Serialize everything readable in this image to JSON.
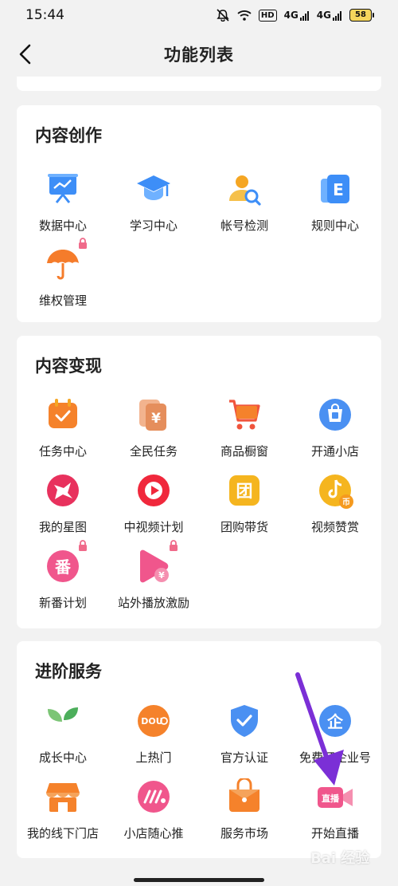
{
  "status_bar": {
    "time": "15:44",
    "hd": "HD",
    "signal1": "4G",
    "signal2": "4G",
    "battery": "58"
  },
  "nav": {
    "title": "功能列表"
  },
  "sections": [
    {
      "title": "内容创作",
      "items": [
        {
          "label": "数据中心",
          "icon": "presentation-chart-icon",
          "locked": false
        },
        {
          "label": "学习中心",
          "icon": "graduation-cap-icon",
          "locked": false
        },
        {
          "label": "帐号检测",
          "icon": "user-search-icon",
          "locked": false
        },
        {
          "label": "规则中心",
          "icon": "rulebook-icon",
          "locked": false
        },
        {
          "label": "维权管理",
          "icon": "umbrella-icon",
          "locked": true
        }
      ]
    },
    {
      "title": "内容变现",
      "items": [
        {
          "label": "任务中心",
          "icon": "calendar-check-icon",
          "locked": false
        },
        {
          "label": "全民任务",
          "icon": "yen-cards-icon",
          "locked": false
        },
        {
          "label": "商品橱窗",
          "icon": "shopping-cart-icon",
          "locked": false
        },
        {
          "label": "开通小店",
          "icon": "shop-bag-icon",
          "locked": false
        },
        {
          "label": "我的星图",
          "icon": "star-map-icon",
          "locked": false
        },
        {
          "label": "中视频计划",
          "icon": "video-play-icon",
          "locked": false
        },
        {
          "label": "团购带货",
          "icon": "group-buy-icon",
          "locked": false
        },
        {
          "label": "视频赞赏",
          "icon": "tiktok-coin-icon",
          "locked": false
        },
        {
          "label": "新番计划",
          "icon": "new-series-icon",
          "locked": true
        },
        {
          "label": "站外播放激励",
          "icon": "play-yen-icon",
          "locked": true
        }
      ]
    },
    {
      "title": "进阶服务",
      "items": [
        {
          "label": "成长中心",
          "icon": "sprout-icon",
          "locked": false
        },
        {
          "label": "上热门",
          "icon": "dou-plus-icon",
          "locked": false
        },
        {
          "label": "官方认证",
          "icon": "verified-shield-icon",
          "locked": false
        },
        {
          "label": "免费开企业号",
          "icon": "enterprise-icon",
          "locked": false
        },
        {
          "label": "我的线下门店",
          "icon": "storefront-icon",
          "locked": false
        },
        {
          "label": "小店随心推",
          "icon": "promote-icon",
          "locked": false
        },
        {
          "label": "服务市场",
          "icon": "service-market-icon",
          "locked": false
        },
        {
          "label": "开始直播",
          "icon": "live-camera-icon",
          "locked": false
        }
      ]
    }
  ],
  "icon_text": {
    "rule": "E",
    "yen": "¥",
    "group": "团",
    "new": "番",
    "coin": "币",
    "dou": "DOU",
    "enterprise": "企",
    "live": "直播"
  },
  "watermark": "Bai 经验",
  "colors": {
    "arrow": "#7b2fd6",
    "background": "#f2f2f2",
    "card": "#ffffff"
  }
}
